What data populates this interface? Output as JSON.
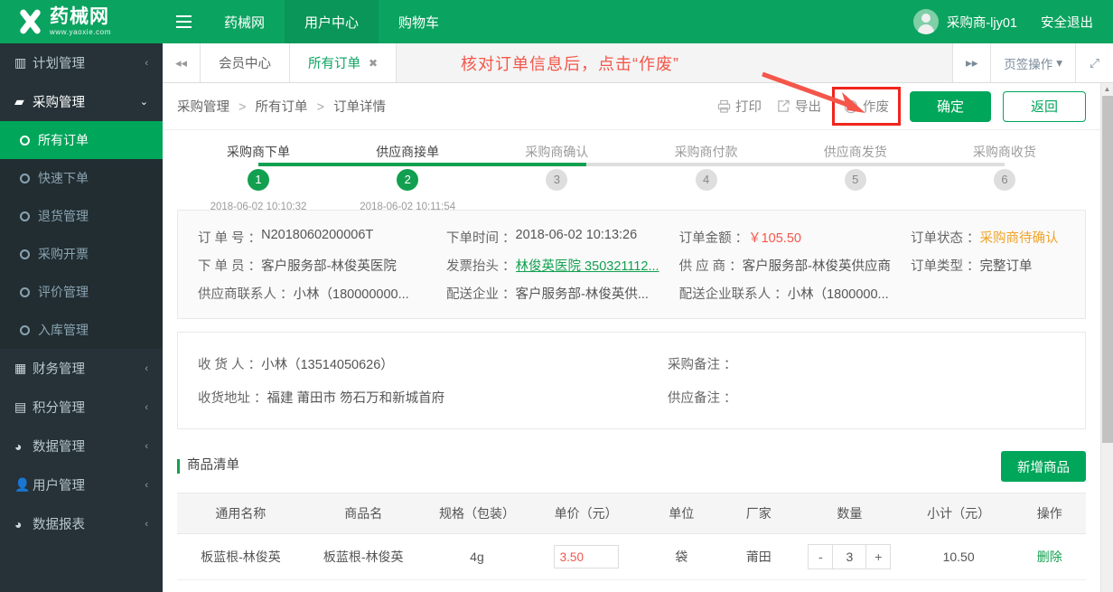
{
  "brand": {
    "name_cn": "药械网",
    "url": "www.yaoxie.com",
    "accent": "#0ba360"
  },
  "topbar": {
    "menu_icon": "hamburger-icon",
    "nav": [
      {
        "label": "药械网",
        "active": false
      },
      {
        "label": "用户中心",
        "active": true
      },
      {
        "label": "购物车",
        "active": false
      }
    ],
    "user_name": "采购商-ljy01",
    "logout_label": "安全退出"
  },
  "sidebar": {
    "items": [
      {
        "label": "计划管理",
        "icon": "chart-bar-icon",
        "arrow": "‹",
        "open": false
      },
      {
        "label": "采购管理",
        "icon": "briefcase-icon",
        "arrow": "⌄",
        "open": true
      },
      {
        "label": "财务管理",
        "icon": "grid-icon",
        "arrow": "‹",
        "open": false
      },
      {
        "label": "积分管理",
        "icon": "database-icon",
        "arrow": "‹",
        "open": false
      },
      {
        "label": "数据管理",
        "icon": "pie-chart-icon",
        "arrow": "‹",
        "open": false
      },
      {
        "label": "用户管理",
        "icon": "user-icon",
        "arrow": "‹",
        "open": false
      },
      {
        "label": "数据报表",
        "icon": "pie-chart-icon",
        "arrow": "‹",
        "open": false
      }
    ],
    "submenu": [
      {
        "label": "所有订单",
        "active": true
      },
      {
        "label": "快速下单",
        "active": false
      },
      {
        "label": "退货管理",
        "active": false
      },
      {
        "label": "采购开票",
        "active": false
      },
      {
        "label": "评价管理",
        "active": false
      },
      {
        "label": "入库管理",
        "active": false
      }
    ]
  },
  "tabbar": {
    "prev_icon": "chevron-double-left-icon",
    "next_icon": "chevron-double-right-icon",
    "tabs": [
      {
        "label": "会员中心",
        "active": false,
        "closable": false
      },
      {
        "label": "所有订单",
        "active": true,
        "closable": true
      }
    ],
    "close_icon": "close-icon",
    "ops_label": "页签操作",
    "ops_caret": "▾",
    "fullscreen_icon": "fullscreen-icon"
  },
  "annotation": {
    "text": "核对订单信息后，点击“作废”",
    "color": "#f4564a",
    "arrow": "annotation-arrow"
  },
  "breadcrumb": {
    "items": [
      "采购管理",
      "所有订单",
      "订单详情"
    ],
    "separator": ">"
  },
  "actions": {
    "print": {
      "label": "打印",
      "icon": "printer-icon"
    },
    "export": {
      "label": "导出",
      "icon": "export-icon"
    },
    "void": {
      "label": "作废",
      "icon": "ban-icon",
      "highlighted": true,
      "highlight_color": "#f0251c"
    },
    "confirm": {
      "label": "确定"
    },
    "back": {
      "label": "返回"
    }
  },
  "steps": [
    {
      "n": "1",
      "label": "采购商下单",
      "time": "2018-06-02 10:10:32",
      "done": true
    },
    {
      "n": "2",
      "label": "供应商接单",
      "time": "2018-06-02 10:11:54",
      "done": true
    },
    {
      "n": "3",
      "label": "采购商确认",
      "time": "",
      "done": false
    },
    {
      "n": "4",
      "label": "采购商付款",
      "time": "",
      "done": false
    },
    {
      "n": "5",
      "label": "供应商发货",
      "time": "",
      "done": false
    },
    {
      "n": "6",
      "label": "采购商收货",
      "time": "",
      "done": false
    }
  ],
  "order_info": {
    "order_no": {
      "label": "订 单 号 ：",
      "value": "N2018060200006T"
    },
    "order_time": {
      "label": "下单时间 ：",
      "value": "2018-06-02 10:13:26"
    },
    "order_amount": {
      "label": "订单金额 ：",
      "value": "￥105.50"
    },
    "order_status": {
      "label": "订单状态 ：",
      "value": "采购商待确认"
    },
    "orderer": {
      "label": "下 单 员 ：",
      "value": "客户服务部-林俊英医院"
    },
    "invoice_title": {
      "label": "发票抬头 ：",
      "value": "林俊英医院 350321112..."
    },
    "supplier": {
      "label": "供 应 商 ：",
      "value": "客户服务部-林俊英供应商"
    },
    "order_type": {
      "label": "订单类型 ：",
      "value": "完整订单"
    },
    "supplier_contact": {
      "label": "供应商联系人 ：",
      "value": "小林（180000000..."
    },
    "delivery_company": {
      "label": "配送企业 ：",
      "value": "客户服务部-林俊英供..."
    },
    "delivery_contact": {
      "label": "配送企业联系人 ：",
      "value": "小林（1800000..."
    }
  },
  "delivery_info": {
    "receiver": {
      "label": "收 货 人 ：",
      "value": "小林（13514050626）"
    },
    "address": {
      "label": "收货地址 ：",
      "value": "福建 莆田市 笏石万和新城首府"
    },
    "purchase_note": {
      "label": "采购备注 ：",
      "value": ""
    },
    "supply_note": {
      "label": "供应备注 ：",
      "value": ""
    }
  },
  "goods": {
    "section_title": "商品清单",
    "add_button": "新增商品",
    "columns": [
      "通用名称",
      "商品名",
      "规格（包装）",
      "单价（元）",
      "单位",
      "厂家",
      "数量",
      "小计（元）",
      "操作"
    ],
    "rows": [
      {
        "generic_name": "板蓝根-林俊英",
        "product_name": "板蓝根-林俊英",
        "spec": "4g",
        "unit_price": "3.50",
        "unit": "袋",
        "factory": "莆田",
        "qty_minus": "-",
        "qty": "3",
        "qty_plus": "+",
        "subtotal": "10.50",
        "op_delete": "删除"
      }
    ]
  },
  "scrollbar": {
    "up_arrow": "▲"
  }
}
